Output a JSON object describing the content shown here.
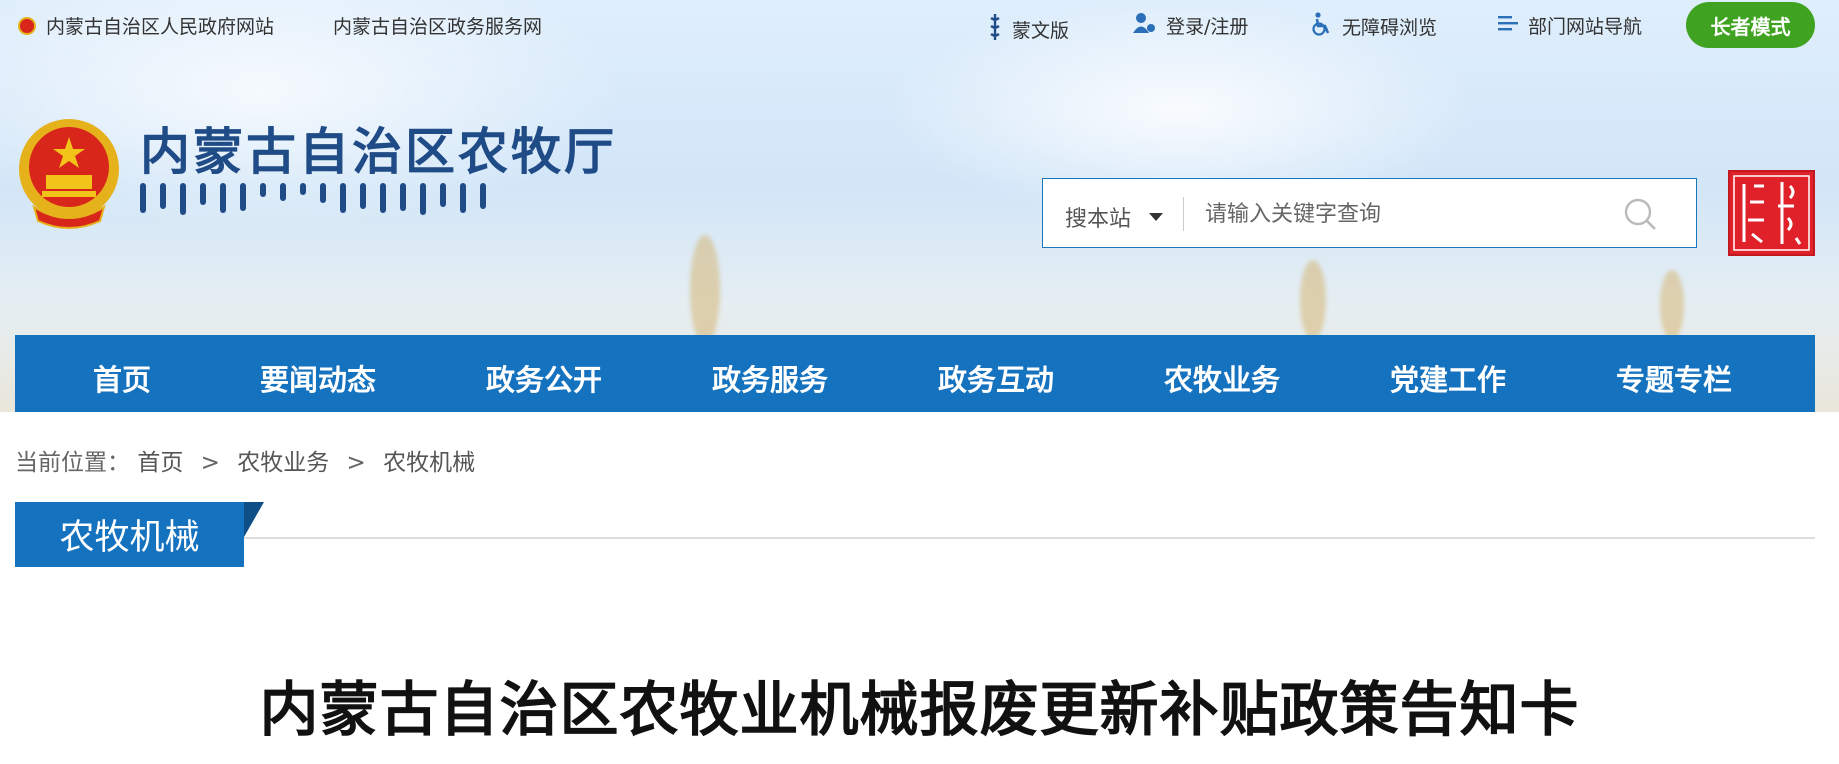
{
  "topbar": {
    "gov_site": "内蒙古自治区人民政府网站",
    "service_site": "内蒙古自治区政务服务网",
    "mongolian_version": "蒙文版",
    "login": "登录/注册",
    "accessibility": "无障碍浏览",
    "dept_nav": "部门网站导航",
    "elder_mode": "长者模式"
  },
  "logo": {
    "title": "内蒙古自治区农牧厅"
  },
  "search": {
    "scope": "搜本站",
    "placeholder": "请输入关键字查询"
  },
  "nav": {
    "items": [
      "首页",
      "要闻动态",
      "政务公开",
      "政务服务",
      "政务互动",
      "农牧业务",
      "党建工作",
      "专题专栏"
    ]
  },
  "breadcrumb": {
    "prefix": "当前位置：",
    "home": "首页",
    "level1": "农牧业务",
    "level2": "农牧机械",
    "sep": ">"
  },
  "section": {
    "title": "农牧机械"
  },
  "article": {
    "title": "内蒙古自治区农牧业机械报废更新补贴政策告知卡"
  },
  "colors": {
    "nav_blue": "#1572bf",
    "elder_green": "#3fa321",
    "title_blue": "#1f4b86"
  },
  "icons": [
    "emblem-icon",
    "mongolian-script-icon",
    "user-icon",
    "wheelchair-icon",
    "menu-icon",
    "search-icon",
    "dropdown-caret-icon"
  ]
}
